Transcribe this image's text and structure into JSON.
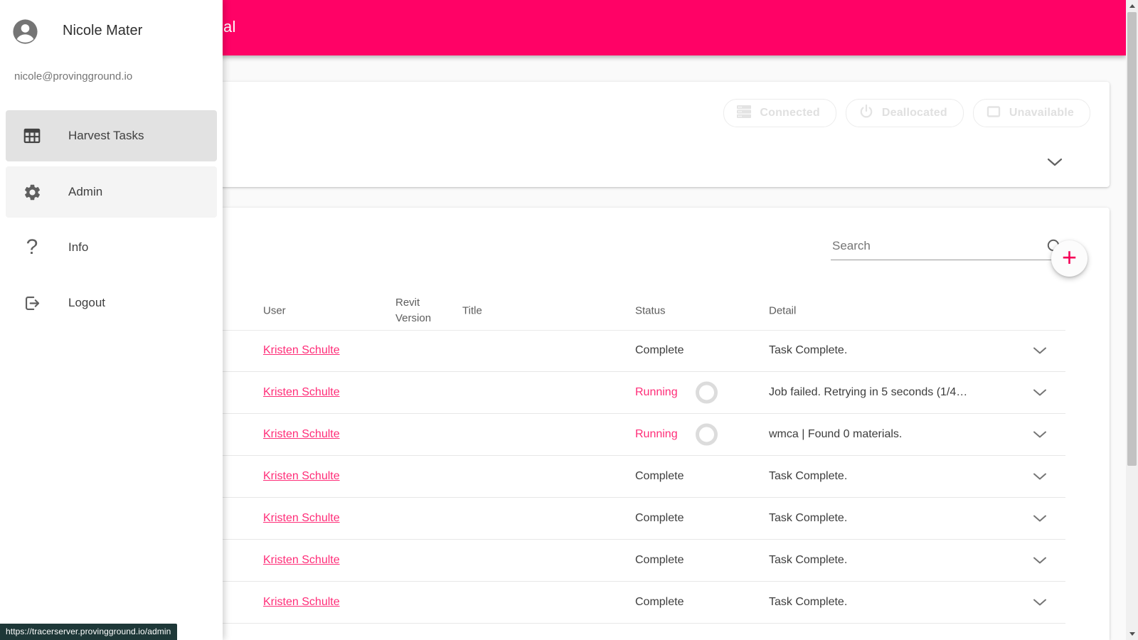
{
  "colors": {
    "appbar_pink": "#ff0266",
    "link_pink": "#ff2d78",
    "fab_plus_pink": "#f50057",
    "disabled_gray": "#e0e0e0",
    "tooltip_bg": "#1e3838"
  },
  "appbar": {
    "title_visible_fragment": "al"
  },
  "drawer": {
    "user": {
      "name": "Nicole Mater",
      "email": "nicole@provingground.io"
    },
    "items": [
      {
        "label": "Harvest Tasks",
        "icon": "table-grid-icon",
        "state": "selected"
      },
      {
        "label": "Admin",
        "icon": "gear-icon",
        "state": "hovered"
      },
      {
        "label": "Info",
        "icon": "question-mark-icon",
        "state": "normal"
      },
      {
        "label": "Logout",
        "icon": "logout-icon",
        "state": "normal"
      }
    ]
  },
  "machine_panel": {
    "buttons": [
      {
        "label": "Connected",
        "icon": "server-stack-icon"
      },
      {
        "label": "Deallocated",
        "icon": "power-icon"
      },
      {
        "label": "Unavailable",
        "icon": "square-monitor-icon"
      }
    ]
  },
  "tasks": {
    "search": {
      "placeholder": "Search",
      "value": ""
    },
    "add_button_label": "+",
    "columns": [
      "User",
      "Revit Version",
      "Title",
      "Status",
      "Detail"
    ],
    "rows": [
      {
        "user": "Kristen Schulte",
        "title": "",
        "revit_version": "",
        "status": "Complete",
        "running": false,
        "detail": "Task Complete."
      },
      {
        "user": "Kristen Schulte",
        "title": "",
        "revit_version": "",
        "status": "Running",
        "running": true,
        "detail": "Job failed. Retrying in 5 seconds (1/4…"
      },
      {
        "user": "Kristen Schulte",
        "title": "",
        "revit_version": "",
        "status": "Running",
        "running": true,
        "detail": "wmca | Found 0 materials."
      },
      {
        "user": "Kristen Schulte",
        "title": "",
        "revit_version": "",
        "status": "Complete",
        "running": false,
        "detail": "Task Complete."
      },
      {
        "user": "Kristen Schulte",
        "title": "",
        "revit_version": "",
        "status": "Complete",
        "running": false,
        "detail": "Task Complete."
      },
      {
        "user": "Kristen Schulte",
        "title": "",
        "revit_version": "",
        "status": "Complete",
        "running": false,
        "detail": "Task Complete."
      },
      {
        "user": "Kristen Schulte",
        "title": "",
        "revit_version": "",
        "status": "Complete",
        "running": false,
        "detail": "Task Complete."
      }
    ]
  },
  "browser": {
    "status_url": "https://tracerserver.provingground.io/admin"
  }
}
